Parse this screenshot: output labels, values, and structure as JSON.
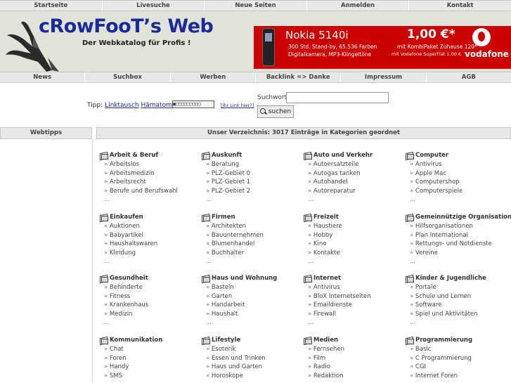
{
  "top_nav": [
    "Startseite",
    "Livesuche",
    "Neue Seiten",
    "Anmelden",
    "Kontakt"
  ],
  "logo": {
    "title": "cRowFooT’s Web",
    "subtitle": "Der Webkatalog für Profis !"
  },
  "banner": {
    "model": "Nokia 5140i",
    "features_1": "300 Std. Stand-by, 65.536 Farben",
    "features_2": "Digitalkamera, MP3-Klingeltöne",
    "price": "1,00 €*",
    "price_info_1": "mit KombiPaket Zuhause 120*",
    "price_info_2": "mit Vodafone SuperFlat 1,00 €",
    "brand": "vodafone"
  },
  "sub_nav": [
    "News",
    "Suchbox",
    "Werben",
    "Backlink => Danke",
    "Impressum",
    "AGB"
  ],
  "tip": {
    "label": "Tipp:",
    "link1": "Linktausch",
    "link2": "Hämatoming",
    "progress_text": "▣▢▢▢▢▢▢▢▢▢",
    "help_link": "[Ihr Link hier?]"
  },
  "search": {
    "label": "Suchwort:",
    "value": "",
    "button": "suchen"
  },
  "sidebar": {
    "title": "Webtipps"
  },
  "main": {
    "title": "Unser Verzeichnis: 3017 Einträge in Kategorien geordnet"
  },
  "categories": [
    {
      "title": "Arbeit & Beruf",
      "subs": [
        "Arbeitslos",
        "Arbeitsmedizin",
        "Arbeitsrecht",
        "Berufe und Berufswahl"
      ],
      "more": "..."
    },
    {
      "title": "Auskunft",
      "subs": [
        "Beratung",
        "PLZ-Gebiet 0",
        "PLZ-Gebiet 1",
        "PLZ-Gebiet 2"
      ],
      "more": "..."
    },
    {
      "title": "Auto und Verkehr",
      "subs": [
        "Autoersatzteile",
        "Autogas tanken",
        "Autohandel",
        "Autoreparatur"
      ],
      "more": "..."
    },
    {
      "title": "Computer",
      "subs": [
        "Antivirus",
        "Apple Mac",
        "Computershop",
        "Computerspiele"
      ],
      "more": "..."
    },
    {
      "title": "Einkaufen",
      "subs": [
        "Auktionen",
        "Babyartikel",
        "Haushaltswaren",
        "Kleidung"
      ],
      "more": "..."
    },
    {
      "title": "Firmen",
      "subs": [
        "Architekten",
        "Bauunternehmen",
        "Blumenhandel",
        "Buchhalter"
      ],
      "more": "..."
    },
    {
      "title": "Freizeit",
      "subs": [
        "Haustiere",
        "Hobby",
        "Kino",
        "Kontakte"
      ],
      "more": "..."
    },
    {
      "title": "Gemeinnützige Organisationen",
      "subs": [
        "Hilfsorganisationen",
        "Plan International",
        "Rettungs- und Notdienste",
        "Vereine"
      ],
      "more": "..."
    },
    {
      "title": "Gesundheit",
      "subs": [
        "Behinderte",
        "Fitness",
        "Krankenhaus",
        "Medizin"
      ],
      "more": "..."
    },
    {
      "title": "Haus und Wohnung",
      "subs": [
        "Basteln",
        "Garten",
        "Handarbeit",
        "Haushalt"
      ],
      "more": "..."
    },
    {
      "title": "Internet",
      "subs": [
        "Antivirus",
        "BloX Internetseiten",
        "Emaildienste",
        "Firewall"
      ],
      "more": "..."
    },
    {
      "title": "Kinder & Jugendliche",
      "subs": [
        "Portale",
        "Schule und Lernen",
        "Software",
        "Spiel und Aktivitäten"
      ],
      "more": "..."
    },
    {
      "title": "Kommunikation",
      "subs": [
        "Chat",
        "Foren",
        "Handy",
        "SMS"
      ],
      "more": ""
    },
    {
      "title": "Lifestyle",
      "subs": [
        "Esoterik",
        "Essen und Trinken",
        "Haus und Garten",
        "Horoskope"
      ],
      "more": ""
    },
    {
      "title": "Medien",
      "subs": [
        "Fernsehen",
        "Film",
        "Radio",
        "Redaktion"
      ],
      "more": ""
    },
    {
      "title": "Programmierung",
      "subs": [
        "Basic",
        "C Programmierung",
        "CGI",
        "Internet Foren"
      ],
      "more": ""
    }
  ]
}
